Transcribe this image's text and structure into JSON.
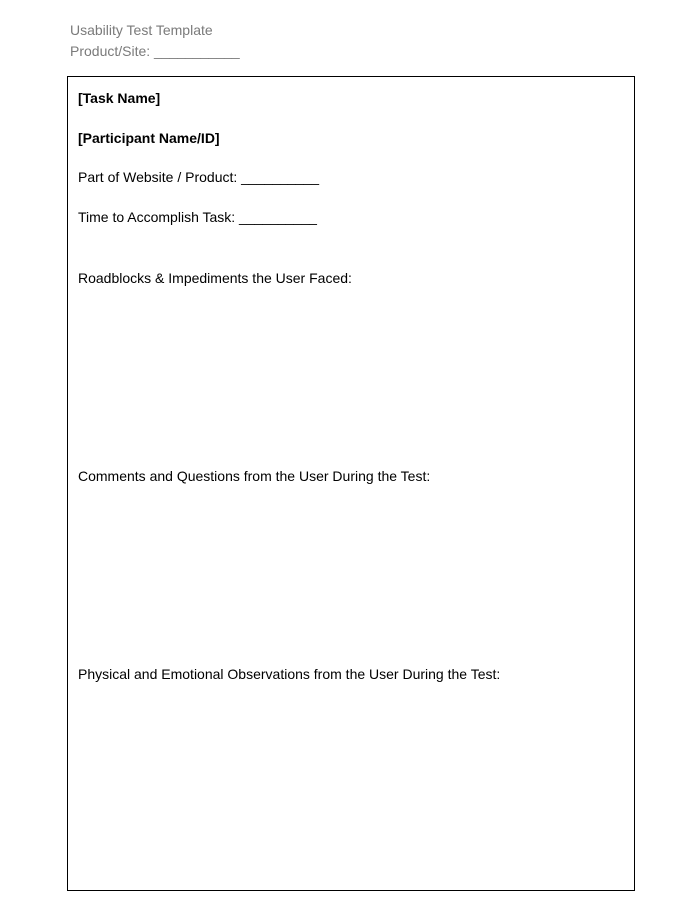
{
  "header": {
    "title": "Usability Test Template",
    "product_site": "Product/Site: ___________"
  },
  "form": {
    "task_name": "[Task Name]",
    "participant": "[Participant Name/ID]",
    "part_website": "Part of Website / Product: __________",
    "time_task": "Time to Accomplish Task: __________",
    "roadblocks": "Roadblocks & Impediments the User Faced:",
    "comments": "Comments and Questions from the User During the Test:",
    "observations": "Physical and Emotional Observations from the User During the Test:"
  }
}
